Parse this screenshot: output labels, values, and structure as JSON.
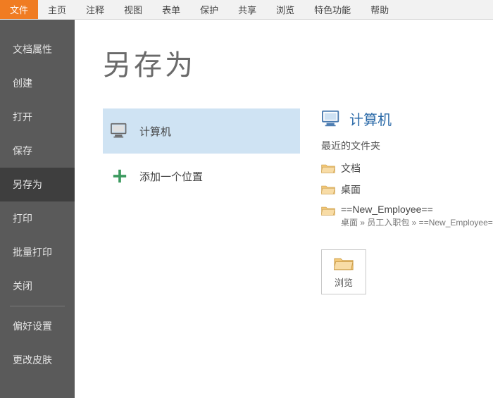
{
  "menubar": {
    "items": [
      "文件",
      "主页",
      "注释",
      "视图",
      "表单",
      "保护",
      "共享",
      "浏览",
      "特色功能",
      "帮助"
    ],
    "activeIndex": 0
  },
  "sidebar": {
    "items": [
      "文档属性",
      "创建",
      "打开",
      "保存",
      "另存为",
      "打印",
      "批量打印",
      "关闭"
    ],
    "activeIndex": 4,
    "footerItems": [
      "偏好设置",
      "更改皮肤"
    ]
  },
  "main": {
    "title": "另存为",
    "locations": [
      {
        "icon": "computer",
        "label": "计算机",
        "selected": true
      },
      {
        "icon": "plus",
        "label": "添加一个位置",
        "selected": false
      }
    ],
    "details": {
      "headerIcon": "computer",
      "headerLabel": "计算机",
      "recentLabel": "最近的文件夹",
      "folders": [
        {
          "name": "文档",
          "path": ""
        },
        {
          "name": "桌面",
          "path": ""
        },
        {
          "name": "==New_Employee==",
          "path": "桌面 » 员工入职包 » ==New_Employee=="
        }
      ],
      "browseLabel": "浏览"
    }
  }
}
